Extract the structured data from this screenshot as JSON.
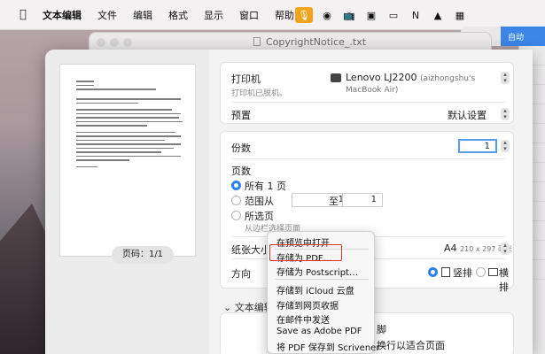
{
  "menubar": {
    "apple": "",
    "items": [
      "文本编辑",
      "文件",
      "编辑",
      "格式",
      "显示",
      "窗口",
      "帮助"
    ],
    "status_icons": [
      "mic-icon",
      "record-icon",
      "tv-icon",
      "image-icon",
      "display-icon",
      "notion-icon",
      "photo-icon",
      "grid-icon"
    ]
  },
  "bg_window": {
    "title_right": "自动"
  },
  "doc_window": {
    "title": "CopyrightNotice_.txt"
  },
  "preview": {
    "page_label": "页码：1/1"
  },
  "printer": {
    "label": "打印机",
    "value": "Lenovo LJ2200",
    "value_detail": "(aizhongshu's MacBook Air)",
    "status": "打印机已脱机。"
  },
  "preset": {
    "label": "预置",
    "value": "默认设置"
  },
  "copies": {
    "label": "份数",
    "value": "1"
  },
  "pages": {
    "label": "页数",
    "all": "所有 1 页",
    "range": "范围从",
    "range_from": "1",
    "range_to_label": "至",
    "range_to": "1",
    "selection": "所选页",
    "selection_sub": "从边栏选择页面"
  },
  "paper": {
    "label": "纸张大小",
    "value": "A4",
    "dims": "210 x 297 毫米"
  },
  "orientation": {
    "label": "方向",
    "portrait": "竖排",
    "landscape": "横排"
  },
  "text_edit_section": {
    "label": "文本编辑",
    "line1": "脚",
    "line2": "换行以适合页面"
  },
  "pdf_menu": {
    "items": [
      "在预览中打开",
      "存储为 PDF…",
      "存储为 Postscript…",
      "存储到 iCloud 云盘",
      "存储到网页收据",
      "在邮件中发送",
      "Save as Adobe PDF",
      "将 PDF 保存到 Scrivener"
    ]
  },
  "colors": {
    "accent": "#2d7ff3",
    "highlight_border": "#e03131",
    "mic_active": "#f0a31f"
  }
}
